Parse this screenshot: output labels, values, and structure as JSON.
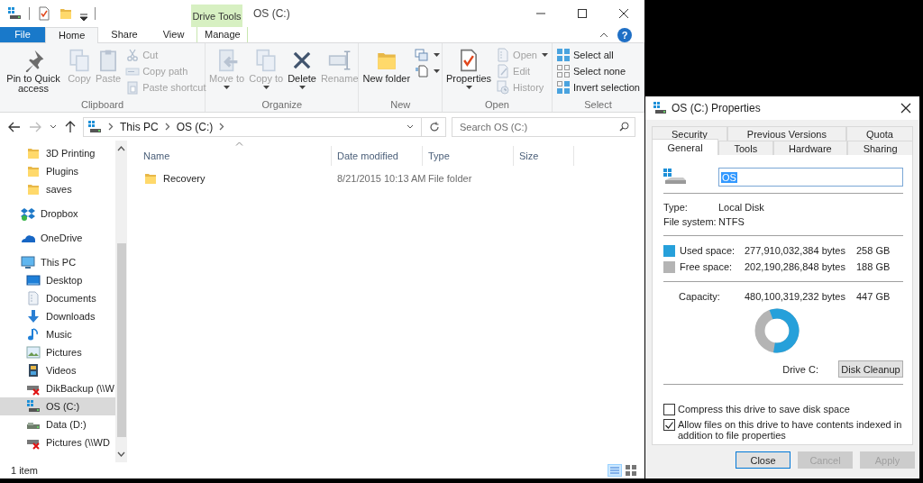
{
  "explorer": {
    "title": "OS (C:)",
    "context_tab_group": "Drive Tools",
    "help_button": "?",
    "ribbon_tabs": [
      {
        "label": "File",
        "kind": "file",
        "selected": false
      },
      {
        "label": "Home",
        "kind": "tab",
        "selected": true
      },
      {
        "label": "Share",
        "kind": "tab",
        "selected": false
      },
      {
        "label": "View",
        "kind": "tab",
        "selected": false
      },
      {
        "label": "Manage",
        "kind": "context",
        "selected": false
      }
    ],
    "ribbon_groups": [
      {
        "label": "Clipboard",
        "buttons": [
          {
            "kind": "large",
            "label": "Pin to Quick access",
            "disabled": false
          },
          {
            "kind": "large",
            "label": "Copy",
            "disabled": true
          },
          {
            "kind": "large",
            "label": "Paste",
            "disabled": true
          },
          {
            "kind": "small",
            "label": "Cut",
            "disabled": true
          },
          {
            "kind": "small",
            "label": "Copy path",
            "disabled": true
          },
          {
            "kind": "small",
            "label": "Paste shortcut",
            "disabled": true
          }
        ]
      },
      {
        "label": "Organize",
        "buttons": [
          {
            "kind": "large",
            "label": "Move to",
            "disabled": true,
            "dropdown": true
          },
          {
            "kind": "large",
            "label": "Copy to",
            "disabled": true,
            "dropdown": true
          },
          {
            "kind": "large",
            "label": "Delete",
            "disabled": false,
            "dropdown": true
          },
          {
            "kind": "large",
            "label": "Rename",
            "disabled": true
          }
        ]
      },
      {
        "label": "New",
        "buttons": [
          {
            "kind": "large",
            "label": "New folder",
            "disabled": false
          },
          {
            "kind": "small",
            "disabled": false,
            "dropdown": true
          },
          {
            "kind": "small",
            "disabled": false,
            "dropdown": true
          }
        ]
      },
      {
        "label": "Open",
        "buttons": [
          {
            "kind": "large",
            "label": "Properties",
            "disabled": false,
            "dropdown": true
          },
          {
            "kind": "small",
            "label": "Open",
            "disabled": true,
            "dropdown": true
          },
          {
            "kind": "small",
            "label": "Edit",
            "disabled": true
          },
          {
            "kind": "small",
            "label": "History",
            "disabled": true
          }
        ]
      },
      {
        "label": "Select",
        "buttons": [
          {
            "kind": "small",
            "label": "Select all",
            "disabled": false
          },
          {
            "kind": "small",
            "label": "Select none",
            "disabled": false
          },
          {
            "kind": "small",
            "label": "Invert selection",
            "disabled": false
          }
        ]
      }
    ],
    "breadcrumbs": [
      "This PC",
      "OS (C:)"
    ],
    "search": {
      "placeholder": "Search OS (C:)"
    },
    "nav_pane": {
      "quick_access_items": [
        {
          "label": "3D Printing",
          "selected": false
        },
        {
          "label": "Plugins",
          "selected": false
        },
        {
          "label": "saves",
          "selected": false
        }
      ],
      "items": [
        {
          "label": "Dropbox",
          "selected": false
        },
        {
          "label": "OneDrive",
          "selected": false
        },
        {
          "label": "This PC",
          "selected": false,
          "children": [
            {
              "label": "Desktop",
              "selected": false
            },
            {
              "label": "Documents",
              "selected": false
            },
            {
              "label": "Downloads",
              "selected": false
            },
            {
              "label": "Music",
              "selected": false
            },
            {
              "label": "Pictures",
              "selected": false
            },
            {
              "label": "Videos",
              "selected": false
            },
            {
              "label": "DikBackup (\\\\W",
              "selected": false
            },
            {
              "label": "OS (C:)",
              "selected": true
            },
            {
              "label": "Data (D:)",
              "selected": false
            },
            {
              "label": "Pictures (\\\\WD",
              "selected": false
            }
          ]
        }
      ]
    },
    "columns": [
      "Name",
      "Date modified",
      "Type",
      "Size"
    ],
    "rows": [
      {
        "name": "Recovery",
        "date_modified": "8/21/2015 10:13 AM",
        "type": "File folder"
      }
    ],
    "status_bar": "1 item"
  },
  "properties_dialog": {
    "title": "OS (C:) Properties",
    "tab_rows": [
      [
        {
          "label": "Security",
          "selected": false
        },
        {
          "label": "Previous Versions",
          "selected": false
        },
        {
          "label": "Quota",
          "selected": false
        }
      ],
      [
        {
          "label": "General",
          "selected": true
        },
        {
          "label": "Tools",
          "selected": false
        },
        {
          "label": "Hardware",
          "selected": false
        },
        {
          "label": "Sharing",
          "selected": false
        }
      ]
    ],
    "name_field": "OS",
    "info": [
      {
        "label": "Type:",
        "value": "Local Disk"
      },
      {
        "label": "File system:",
        "value": "NTFS"
      }
    ],
    "space": [
      {
        "label": "Used space:",
        "bytes": "277,910,032,384 bytes",
        "size": "258 GB",
        "color": "#26a0da"
      },
      {
        "label": "Free space:",
        "bytes": "202,190,286,848 bytes",
        "size": "188 GB",
        "color": "#b4b4b4"
      }
    ],
    "capacity": {
      "label": "Capacity:",
      "bytes": "480,100,319,232 bytes",
      "size": "447 GB"
    },
    "drive_label": "Drive C:",
    "cleanup_button": "Disk Cleanup",
    "options": [
      {
        "label": "Compress this drive to save disk space",
        "checked": false
      },
      {
        "label": "Allow files on this drive to have contents indexed in addition to file properties",
        "checked": true
      }
    ],
    "buttons": [
      {
        "label": "Close",
        "kind": "default",
        "disabled": false
      },
      {
        "label": "Cancel",
        "kind": "normal",
        "disabled": true
      },
      {
        "label": "Apply",
        "kind": "normal",
        "disabled": true
      }
    ]
  }
}
